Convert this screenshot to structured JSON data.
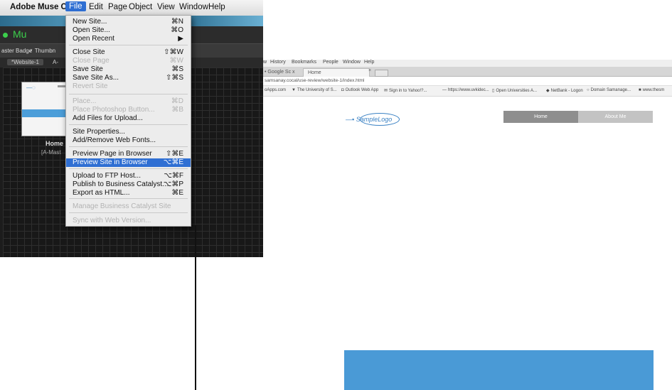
{
  "muse": {
    "menubar": [
      "Adobe Muse CC",
      "File",
      "Edit",
      "Page",
      "Object",
      "View",
      "Window",
      "Help"
    ],
    "app_title": "Mu",
    "toolbar": [
      "aster Badge",
      "✓ Thumbn"
    ],
    "tabs": [
      "*Website-1",
      "A-"
    ],
    "page_thumb": {
      "logo": "—◌",
      "name": "Home",
      "master": "[A-Mast"
    }
  },
  "file_menu": {
    "items": [
      {
        "label": "New Site...",
        "shortcut": "⌘N",
        "state": "enabled"
      },
      {
        "label": "Open Site...",
        "shortcut": "⌘O",
        "state": "enabled"
      },
      {
        "label": "Open Recent",
        "shortcut": "▶",
        "state": "enabled"
      },
      {
        "label": "Close Site",
        "shortcut": "⇧⌘W",
        "state": "enabled"
      },
      {
        "label": "Close Page",
        "shortcut": "⌘W",
        "state": "disabled"
      },
      {
        "label": "Save Site",
        "shortcut": "⌘S",
        "state": "enabled"
      },
      {
        "label": "Save Site As...",
        "shortcut": "⇧⌘S",
        "state": "enabled"
      },
      {
        "label": "Revert Site",
        "shortcut": "",
        "state": "disabled"
      },
      {
        "label": "Place...",
        "shortcut": "⌘D",
        "state": "disabled"
      },
      {
        "label": "Place Photoshop Button...",
        "shortcut": "⌘B",
        "state": "disabled"
      },
      {
        "label": "Add Files for Upload...",
        "shortcut": "",
        "state": "enabled"
      },
      {
        "label": "Site Properties...",
        "shortcut": "",
        "state": "enabled"
      },
      {
        "label": "Add/Remove Web Fonts...",
        "shortcut": "",
        "state": "enabled"
      },
      {
        "label": "Preview Page in Browser",
        "shortcut": "⇧⌘E",
        "state": "enabled"
      },
      {
        "label": "Preview Site in Browser",
        "shortcut": "⌥⌘E",
        "state": "highlighted"
      },
      {
        "label": "Upload to FTP Host...",
        "shortcut": "⌥⌘F",
        "state": "enabled"
      },
      {
        "label": "Publish to Business Catalyst...",
        "shortcut": "⌥⌘P",
        "state": "enabled"
      },
      {
        "label": "Export as HTML...",
        "shortcut": "⌘E",
        "state": "enabled"
      },
      {
        "label": "Manage Business Catalyst Site",
        "shortcut": "",
        "state": "disabled"
      },
      {
        "label": "Sync with Web Version...",
        "shortcut": "",
        "state": "disabled"
      }
    ]
  },
  "browser": {
    "menubar": [
      "w",
      "History",
      "Bookmarks",
      "People",
      "Window",
      "Help"
    ],
    "tabs": {
      "google": "• Google Sc x",
      "home": "Home",
      "home_close": "×"
    },
    "address": "samsanay.cocal/use-review/website-1/index.html",
    "bookmarks": [
      {
        "icon": "",
        "label": "oApps.com"
      },
      {
        "icon": "▼",
        "label": "The University of S..."
      },
      {
        "icon": "◘",
        "label": "Outlook Web App"
      },
      {
        "icon": "✉",
        "label": "Sign in to Yahoo!?..."
      },
      {
        "icon": "—",
        "label": "https://www.uvkidec..."
      },
      {
        "icon": "▯",
        "label": "Open Universities A..."
      },
      {
        "icon": "◆",
        "label": "NetBank - Logon"
      },
      {
        "icon": "○",
        "label": "Domain Samanage..."
      },
      {
        "icon": "■",
        "label": "www.thesm"
      }
    ],
    "site": {
      "logo": "SampleLogo",
      "logo_prefix": "—▪",
      "nav": [
        "Home",
        "About Me"
      ]
    }
  },
  "colors": {
    "menu_highlight": "#2f6fd3",
    "muse_green": "#3ccf4c",
    "site_blue": "#4a9ad6",
    "nav_active": "#8e8e8e",
    "nav_inactive": "#c3c3c3"
  }
}
